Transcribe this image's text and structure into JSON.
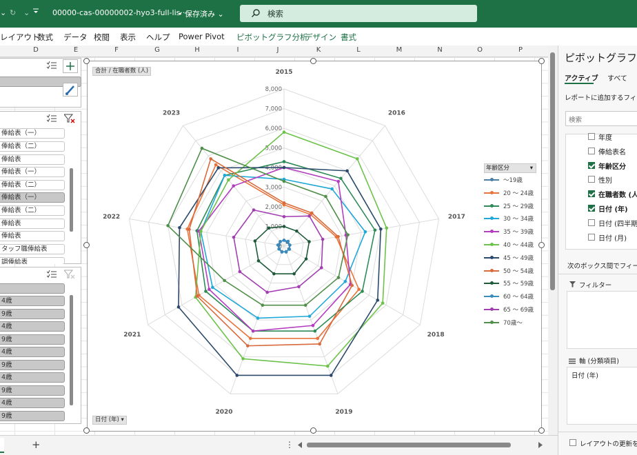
{
  "titlebar": {
    "undo_arrow": "⌄",
    "redo_icon": "↻",
    "qat_icon": "⌄",
    "filename": "00000-cas-00000002-hyo3-full-lis···",
    "save_status": "• 保存済み ⌄",
    "search_placeholder": "検索"
  },
  "ribbon": {
    "items": [
      "レイアウト",
      "数式",
      "データ",
      "校閲",
      "表示",
      "ヘルプ",
      "Power Pivot",
      "ピボットグラフ分析",
      "デザイン",
      "書式"
    ]
  },
  "columns": [
    "D",
    "E",
    "F",
    "G",
    "H",
    "I",
    "J",
    "K",
    "L",
    "M",
    "N",
    "O",
    "P"
  ],
  "slicer1": {
    "items": []
  },
  "slicer2": {
    "items": [
      "俸給表（一）",
      "俸給表（二）",
      "俸給表",
      "俸給表（一）",
      "俸給表（二）",
      "俸給表（一）",
      "俸給表（二）",
      "俸給表",
      "俸給表",
      "タッフ職俸給表",
      "調俸給表"
    ]
  },
  "slicer3": {
    "items": [
      "",
      "4歳",
      "9歳",
      "4歳",
      "9歳",
      "4歳",
      "9歳",
      "4歳",
      "9歳",
      "4歳",
      "9歳",
      "4歳",
      "9歳"
    ]
  },
  "chart": {
    "field_value": "合計 / 在職者数 (人)",
    "field_axis": "日付 (年) ▾",
    "legend_title": "年齢区分",
    "legend_dropdown": "▾"
  },
  "chart_data": {
    "type": "radar",
    "categories": [
      "2015",
      "2016",
      "2017",
      "2018",
      "2019",
      "2020",
      "2021",
      "2022",
      "2023"
    ],
    "rlim": [
      0,
      8000
    ],
    "ticks": [
      "0",
      "1,000",
      "2,000",
      "3,000",
      "4,000",
      "5,000",
      "6,000",
      "7,000",
      "8,000"
    ],
    "series": [
      {
        "name": "～19歳",
        "color": "#4a7fa4",
        "values": [
          300,
          250,
          300,
          280,
          320,
          300,
          280,
          260,
          300
        ]
      },
      {
        "name": "20 ～ 24歳",
        "color": "#e8743b",
        "values": [
          2100,
          2100,
          2700,
          4400,
          5000,
          5000,
          5000,
          5000,
          5400
        ]
      },
      {
        "name": "25 ～ 29歳",
        "color": "#2e8b57",
        "values": [
          4300,
          4500,
          4700,
          4600,
          4600,
          4600,
          4600,
          4500,
          4700
        ]
      },
      {
        "name": "30 ～ 34歳",
        "color": "#20a8d8",
        "values": [
          3400,
          3800,
          4200,
          3600,
          3800,
          3900,
          4200,
          4300,
          4700
        ]
      },
      {
        "name": "35 ～ 39歳",
        "color": "#b43cc0",
        "values": [
          4000,
          4300,
          3200,
          3900,
          4300,
          4600,
          4400,
          4400,
          4000
        ]
      },
      {
        "name": "40 ～ 44歳",
        "color": "#6dc24b",
        "values": [
          5800,
          5800,
          5300,
          5800,
          6500,
          6100,
          5200,
          4300,
          4400
        ]
      },
      {
        "name": "45 ～ 49歳",
        "color": "#2b4a6b",
        "values": [
          4000,
          5000,
          5000,
          5500,
          7000,
          7000,
          6200,
          5400,
          5200
        ]
      },
      {
        "name": "50 ～ 54歳",
        "color": "#d96a3c",
        "values": [
          2200,
          2200,
          2800,
          4000,
          5300,
          5400,
          5100,
          4900,
          5800
        ]
      },
      {
        "name": "55 ～ 59歳",
        "color": "#1f5a3a",
        "values": [
          1000,
          1000,
          1300,
          1300,
          1500,
          1500,
          1500,
          1500,
          1200
        ]
      },
      {
        "name": "60 ～ 64歳",
        "color": "#3a8bbd",
        "values": [
          300,
          320,
          300,
          320,
          300,
          320,
          300,
          320,
          300
        ]
      },
      {
        "name": "65 ～ 69歳",
        "color": "#a13fb0",
        "values": [
          1500,
          2000,
          2000,
          2200,
          2200,
          2500,
          2600,
          2600,
          2400
        ]
      },
      {
        "name": "70歳～",
        "color": "#4f8f4a",
        "values": [
          3300,
          3300,
          3300,
          3200,
          3200,
          3200,
          3500,
          6000,
          6500
        ]
      }
    ]
  },
  "pane": {
    "title": "ピボットグラフの",
    "tab_active": "アクティブ",
    "tab_all": "すべて",
    "hint": "レポートに追加するフィール",
    "search_placeholder": "検索",
    "fields": [
      {
        "label": "年度",
        "checked": false
      },
      {
        "label": "俸給表名",
        "checked": false
      },
      {
        "label": "年齢区分",
        "checked": true
      },
      {
        "label": "性別",
        "checked": false
      },
      {
        "label": "在職者数 (人",
        "checked": true
      },
      {
        "label": "日付 (年)",
        "checked": true
      },
      {
        "label": "日付 (四半期",
        "checked": false
      },
      {
        "label": "日付 (月)",
        "checked": false
      }
    ],
    "drag_hint": "次のボックス間でフィールド",
    "filter_label": "フィルター",
    "axis_label": "軸 (分類項目)",
    "axis_value": "日付 (年)",
    "defer_label": "レイアウトの更新を保"
  },
  "bottom": {
    "add_sheet": "+",
    "more": "⋮"
  }
}
